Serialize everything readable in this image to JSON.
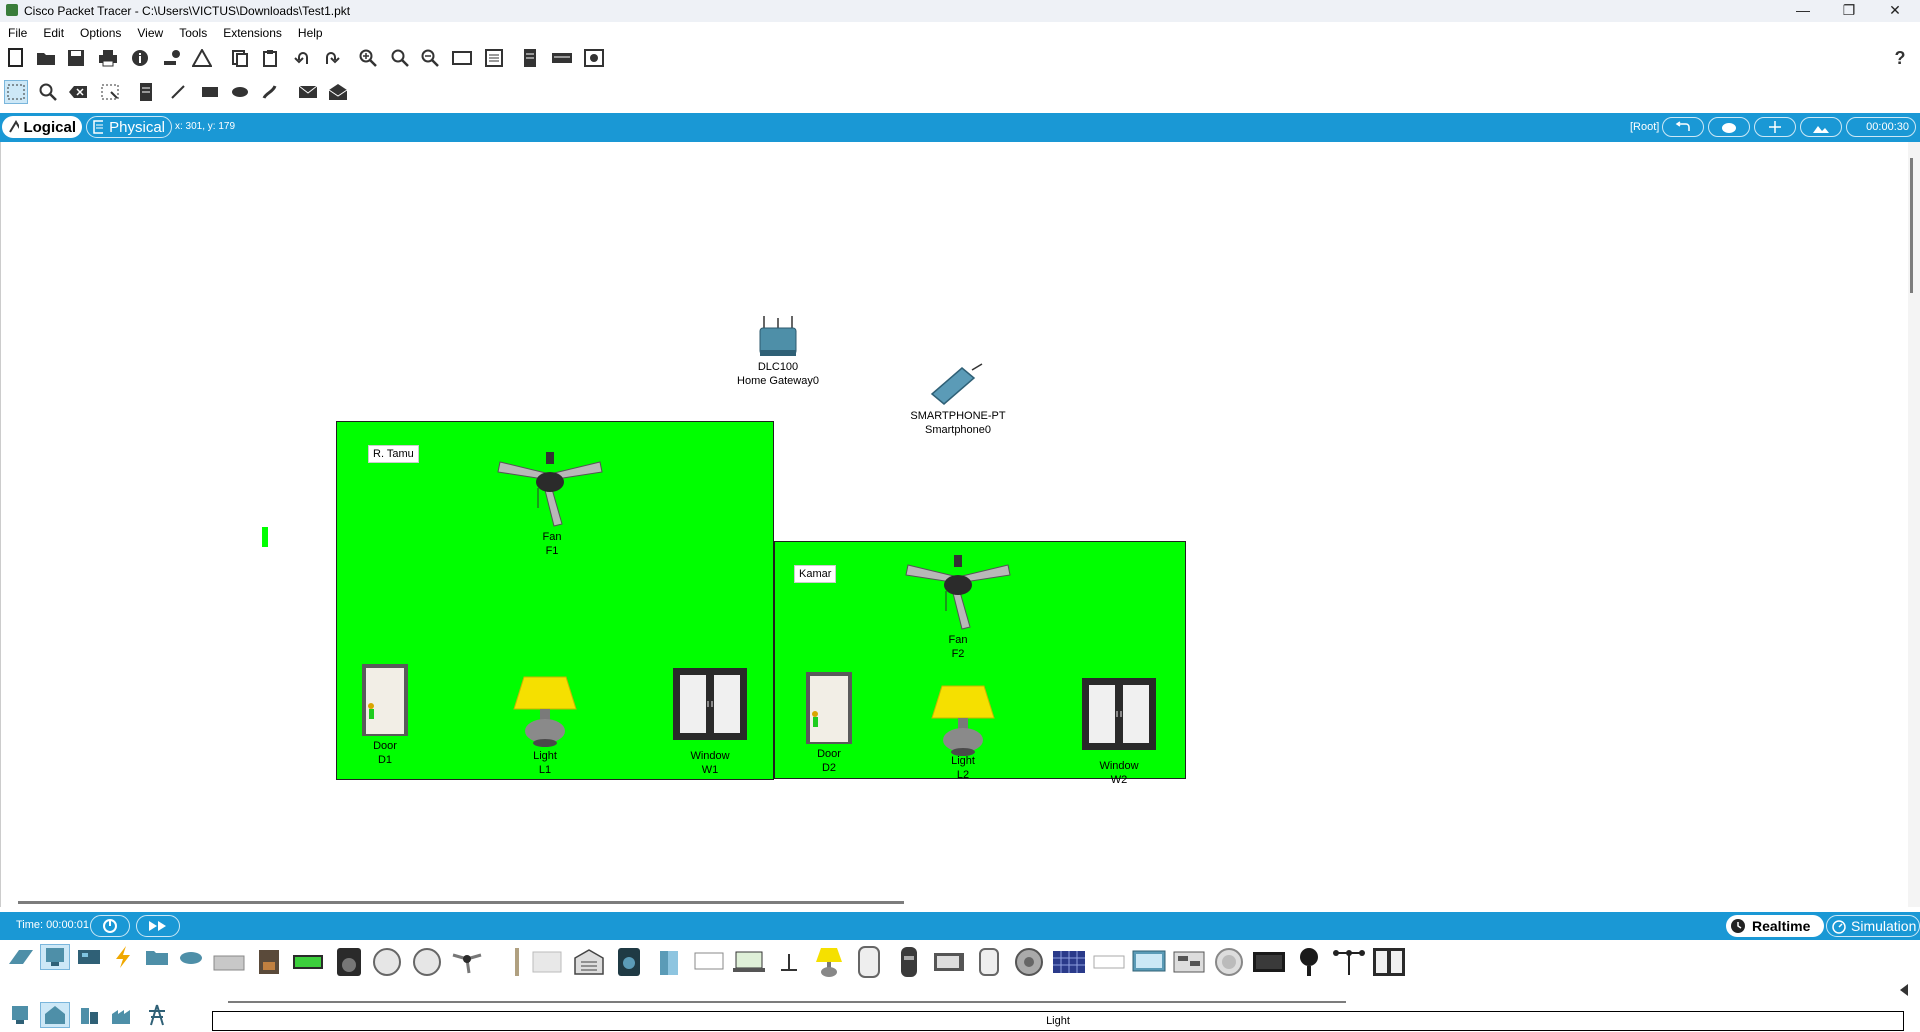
{
  "window": {
    "title": "Cisco Packet Tracer - C:\\Users\\VICTUS\\Downloads\\Test1.pkt",
    "minimize": "—",
    "restore": "❐",
    "close": "✕"
  },
  "menu": {
    "items": [
      "File",
      "Edit",
      "Options",
      "View",
      "Tools",
      "Extensions",
      "Help"
    ]
  },
  "toolbar": {
    "help": "?"
  },
  "modebar": {
    "logical": "Logical",
    "physical": "Physical",
    "coords": "x: 301, y: 179",
    "root": "[Root]",
    "time": "00:00:30"
  },
  "rooms": [
    {
      "name": "R. Tamu"
    },
    {
      "name": "Kamar"
    }
  ],
  "devices": {
    "gateway": {
      "model": "DLC100",
      "name": "Home Gateway0"
    },
    "smartphone": {
      "model": "SMARTPHONE-PT",
      "name": "Smartphone0"
    },
    "fan1": {
      "model": "Fan",
      "name": "F1"
    },
    "fan2": {
      "model": "Fan",
      "name": "F2"
    },
    "door1": {
      "model": "Door",
      "name": "D1"
    },
    "door2": {
      "model": "Door",
      "name": "D2"
    },
    "light1": {
      "model": "Light",
      "name": "L1"
    },
    "light2": {
      "model": "Light",
      "name": "L2"
    },
    "window1": {
      "model": "Window",
      "name": "W1"
    },
    "window2": {
      "model": "Window",
      "name": "W2"
    }
  },
  "bottombar": {
    "time": "Time: 00:00:01",
    "realtime": "Realtime",
    "simulation": "Simulation"
  },
  "status": {
    "selected": "Light"
  },
  "colors": {
    "room": "#00ff00",
    "accent": "#1a98d5"
  }
}
